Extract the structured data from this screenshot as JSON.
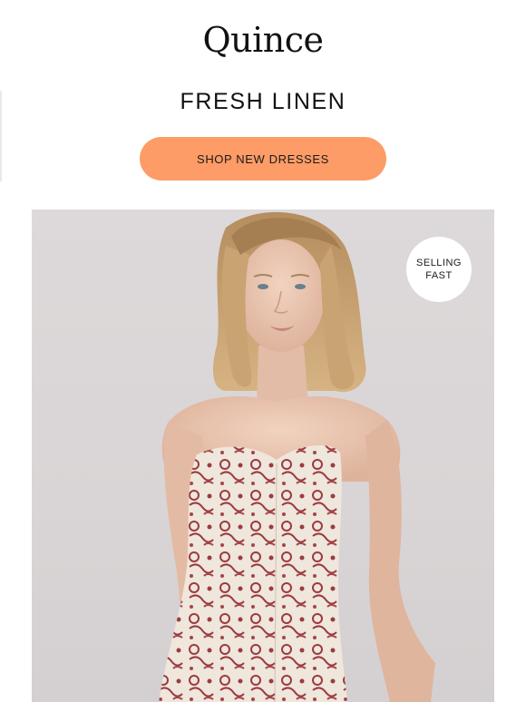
{
  "brand": {
    "logo_text": "Quince"
  },
  "header": {
    "headline": "FRESH LINEN"
  },
  "cta": {
    "label": "SHOP NEW DRESSES",
    "color": "#fd9c66"
  },
  "hero": {
    "badge_line1": "SELLING",
    "badge_line2": "FAST",
    "background_color": "#dcd8d9",
    "dress_print_color": "#9b3b3f"
  }
}
